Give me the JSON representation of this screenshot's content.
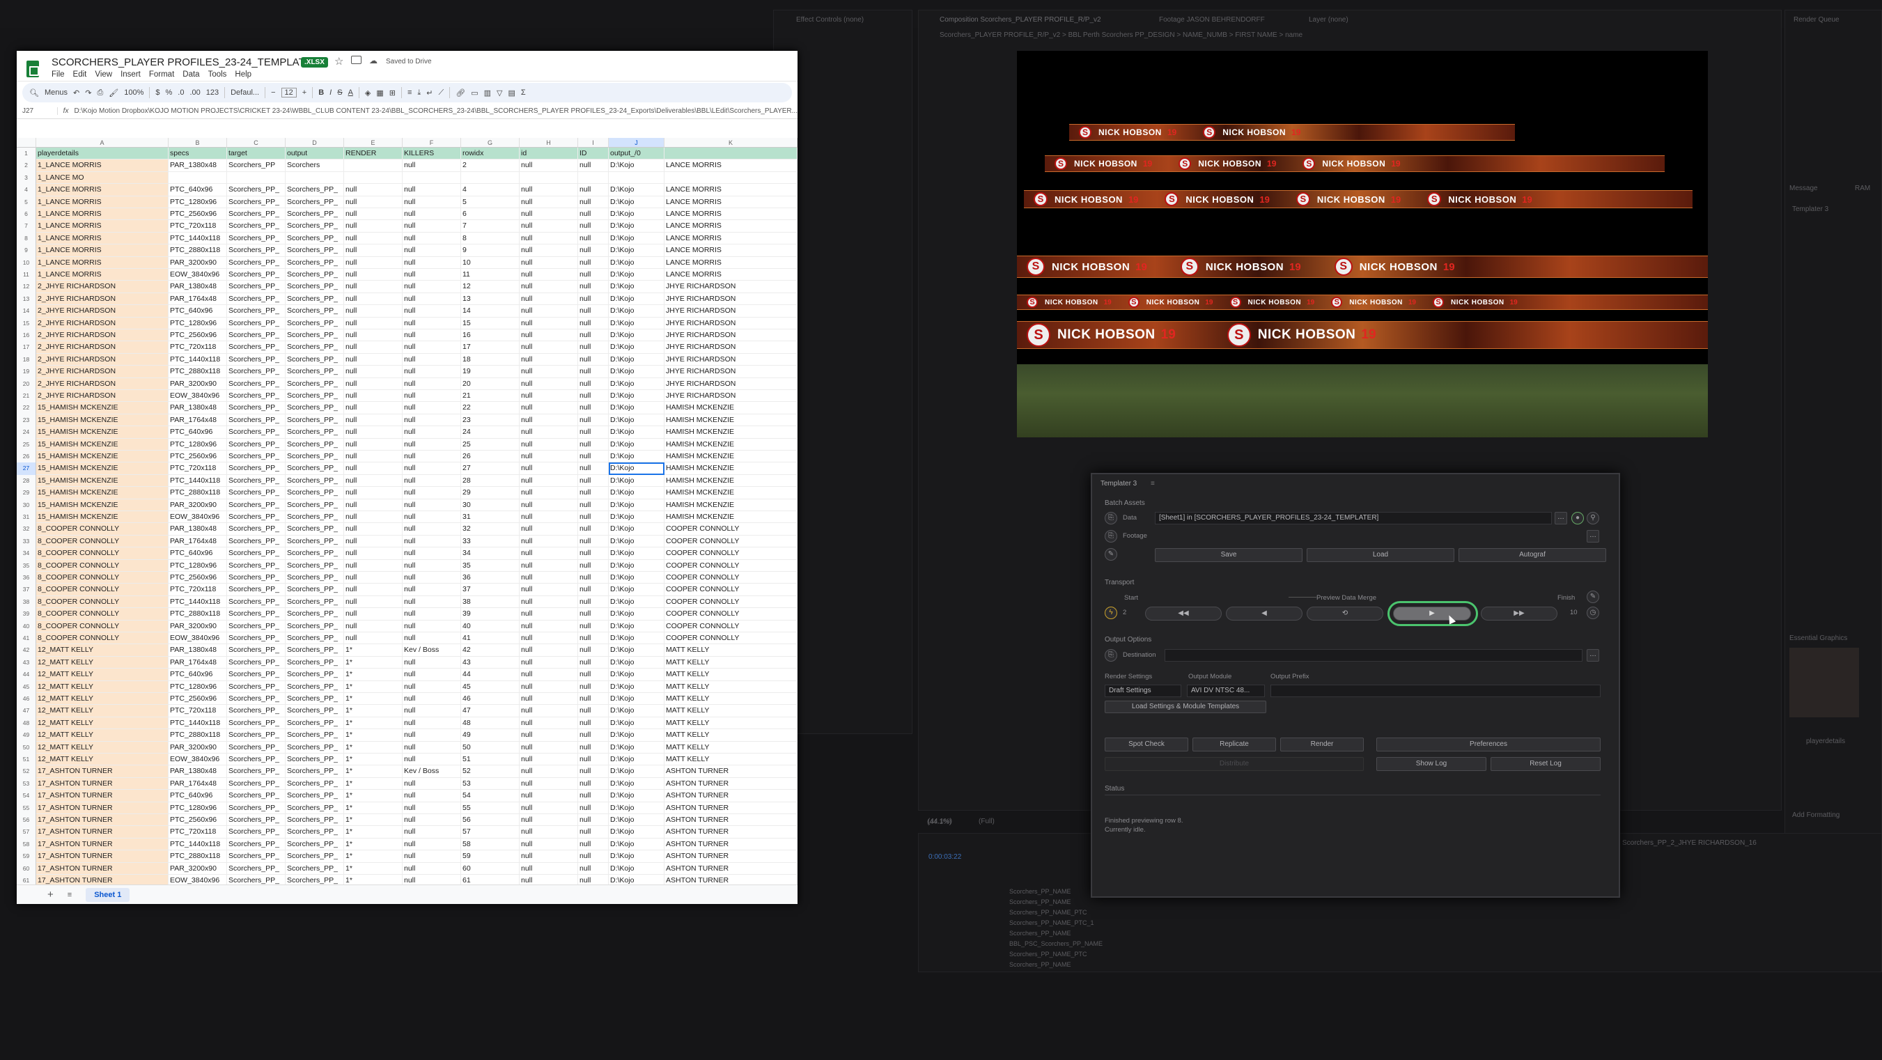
{
  "ae": {
    "effect_controls": "Effect Controls (none)",
    "comp_tab": "Composition Scorchers_PLAYER PROFILE_R/P_v2",
    "footage_tab": "Footage JASON BEHRENDORFF",
    "layer_tab": "Layer (none)",
    "render_queue": "Render Queue",
    "comp_breadcrumb": "Scorchers_PLAYER PROFILE_R/P_v2  >  BBL Perth Scorchers PP_DESIGN  >  NAME_NUMB  >  FIRST NAME  >  name",
    "zoom": "(44.1%)",
    "resolution": "(Full)",
    "timecode": "0:00:03:22",
    "timeline_tab": "Scorchers_PP_2_JHYE RICHARDSON_16",
    "right_tabs": [
      "Message",
      "RAM"
    ],
    "right_panel_title": "Templater 3",
    "essential_graphics": "Essential Graphics",
    "eg_layer": "playerdetails",
    "add_formatting": "Add Formatting",
    "layer_rows": [
      "Scorchers_PP_NAME",
      "Scorchers_PP_NAME",
      "Scorchers_PP_NAME_PTC",
      "Scorchers_PP_NAME_PTC_1",
      "Scorchers_PP_NAME",
      "BBL_PSC_Scorchers_PP_NAME",
      "Scorchers_PP_NAME_PTC",
      "Scorchers_PP_NAME"
    ]
  },
  "sheets": {
    "title": "SCORCHERS_PLAYER PROFILES_23-24_TEMPLATER",
    "badge": ".XLSX",
    "saved": "Saved to Drive",
    "menu": [
      "File",
      "Edit",
      "View",
      "Insert",
      "Format",
      "Data",
      "Tools",
      "Help"
    ],
    "toolbar": {
      "search": "Menus",
      "zoom": "100%",
      "currency": "$",
      "percent": "%",
      "dec1": ".0",
      "dec2": ".00",
      "fmt": "123",
      "font": "Defaul...",
      "size": "12"
    },
    "cell_ref": "J27",
    "formula": "D:\\Kojo Motion Dropbox\\KOJO MOTION PROJECTS\\CRICKET 23-24\\WBBL_CLUB CONTENT 23-24\\BBL_SCORCHERS_23-24\\BBL_SCORCHERS_PLAYER PROFILES_23-24_Exports\\Deliverables\\BBL\\LEdit\\Scorchers_PLAYER...",
    "columns": [
      "A",
      "B",
      "C",
      "D",
      "E",
      "F",
      "G",
      "H",
      "I",
      "J",
      "K"
    ],
    "header_row": [
      "playerdetails",
      "specs",
      "target",
      "output",
      "RENDER",
      "KILLERS",
      "rowidx",
      "id",
      "ID",
      "output_/0",
      ""
    ],
    "rows": [
      [
        "1_LANCE MORRIS",
        "PAR_1380x48",
        "Scorchers_PP",
        "Scorchers",
        "",
        "null",
        "2",
        "null",
        "null",
        "D:\\Kojo",
        "LANCE MORRIS"
      ],
      [
        "1_LANCE MO",
        "",
        "",
        "",
        "",
        "",
        "",
        "",
        "",
        "",
        ""
      ],
      [
        "1_LANCE MORRIS",
        "PTC_640x96",
        "Scorchers_PP_",
        "Scorchers_PP_",
        "null",
        "null",
        "4",
        "null",
        "null",
        "D:\\Kojo",
        "LANCE MORRIS"
      ],
      [
        "1_LANCE MORRIS",
        "PTC_1280x96",
        "Scorchers_PP_",
        "Scorchers_PP_",
        "null",
        "null",
        "5",
        "null",
        "null",
        "D:\\Kojo",
        "LANCE MORRIS"
      ],
      [
        "1_LANCE MORRIS",
        "PTC_2560x96",
        "Scorchers_PP_",
        "Scorchers_PP_",
        "null",
        "null",
        "6",
        "null",
        "null",
        "D:\\Kojo",
        "LANCE MORRIS"
      ],
      [
        "1_LANCE MORRIS",
        "PTC_720x118",
        "Scorchers_PP_",
        "Scorchers_PP_",
        "null",
        "null",
        "7",
        "null",
        "null",
        "D:\\Kojo",
        "LANCE MORRIS"
      ],
      [
        "1_LANCE MORRIS",
        "PTC_1440x118",
        "Scorchers_PP_",
        "Scorchers_PP_",
        "null",
        "null",
        "8",
        "null",
        "null",
        "D:\\Kojo",
        "LANCE MORRIS"
      ],
      [
        "1_LANCE MORRIS",
        "PTC_2880x118",
        "Scorchers_PP_",
        "Scorchers_PP_",
        "null",
        "null",
        "9",
        "null",
        "null",
        "D:\\Kojo",
        "LANCE MORRIS"
      ],
      [
        "1_LANCE MORRIS",
        "PAR_3200x90",
        "Scorchers_PP_",
        "Scorchers_PP_",
        "null",
        "null",
        "10",
        "null",
        "null",
        "D:\\Kojo",
        "LANCE MORRIS"
      ],
      [
        "1_LANCE MORRIS",
        "EOW_3840x96",
        "Scorchers_PP_",
        "Scorchers_PP_",
        "null",
        "null",
        "11",
        "null",
        "null",
        "D:\\Kojo",
        "LANCE MORRIS"
      ],
      [
        "2_JHYE RICHARDSON",
        "PAR_1380x48",
        "Scorchers_PP_",
        "Scorchers_PP_",
        "null",
        "null",
        "12",
        "null",
        "null",
        "D:\\Kojo",
        "JHYE RICHARDSON"
      ],
      [
        "2_JHYE RICHARDSON",
        "PAR_1764x48",
        "Scorchers_PP_",
        "Scorchers_PP_",
        "null",
        "null",
        "13",
        "null",
        "null",
        "D:\\Kojo",
        "JHYE RICHARDSON"
      ],
      [
        "2_JHYE RICHARDSON",
        "PTC_640x96",
        "Scorchers_PP_",
        "Scorchers_PP_",
        "null",
        "null",
        "14",
        "null",
        "null",
        "D:\\Kojo",
        "JHYE RICHARDSON"
      ],
      [
        "2_JHYE RICHARDSON",
        "PTC_1280x96",
        "Scorchers_PP_",
        "Scorchers_PP_",
        "null",
        "null",
        "15",
        "null",
        "null",
        "D:\\Kojo",
        "JHYE RICHARDSON"
      ],
      [
        "2_JHYE RICHARDSON",
        "PTC_2560x96",
        "Scorchers_PP_",
        "Scorchers_PP_",
        "null",
        "null",
        "16",
        "null",
        "null",
        "D:\\Kojo",
        "JHYE RICHARDSON"
      ],
      [
        "2_JHYE RICHARDSON",
        "PTC_720x118",
        "Scorchers_PP_",
        "Scorchers_PP_",
        "null",
        "null",
        "17",
        "null",
        "null",
        "D:\\Kojo",
        "JHYE RICHARDSON"
      ],
      [
        "2_JHYE RICHARDSON",
        "PTC_1440x118",
        "Scorchers_PP_",
        "Scorchers_PP_",
        "null",
        "null",
        "18",
        "null",
        "null",
        "D:\\Kojo",
        "JHYE RICHARDSON"
      ],
      [
        "2_JHYE RICHARDSON",
        "PTC_2880x118",
        "Scorchers_PP_",
        "Scorchers_PP_",
        "null",
        "null",
        "19",
        "null",
        "null",
        "D:\\Kojo",
        "JHYE RICHARDSON"
      ],
      [
        "2_JHYE RICHARDSON",
        "PAR_3200x90",
        "Scorchers_PP_",
        "Scorchers_PP_",
        "null",
        "null",
        "20",
        "null",
        "null",
        "D:\\Kojo",
        "JHYE RICHARDSON"
      ],
      [
        "2_JHYE RICHARDSON",
        "EOW_3840x96",
        "Scorchers_PP_",
        "Scorchers_PP_",
        "null",
        "null",
        "21",
        "null",
        "null",
        "D:\\Kojo",
        "JHYE RICHARDSON"
      ],
      [
        "15_HAMISH MCKENZIE",
        "PAR_1380x48",
        "Scorchers_PP_",
        "Scorchers_PP_",
        "null",
        "null",
        "22",
        "null",
        "null",
        "D:\\Kojo",
        "HAMISH MCKENZIE"
      ],
      [
        "15_HAMISH MCKENZIE",
        "PAR_1764x48",
        "Scorchers_PP_",
        "Scorchers_PP_",
        "null",
        "null",
        "23",
        "null",
        "null",
        "D:\\Kojo",
        "HAMISH MCKENZIE"
      ],
      [
        "15_HAMISH MCKENZIE",
        "PTC_640x96",
        "Scorchers_PP_",
        "Scorchers_PP_",
        "null",
        "null",
        "24",
        "null",
        "null",
        "D:\\Kojo",
        "HAMISH MCKENZIE"
      ],
      [
        "15_HAMISH MCKENZIE",
        "PTC_1280x96",
        "Scorchers_PP_",
        "Scorchers_PP_",
        "null",
        "null",
        "25",
        "null",
        "null",
        "D:\\Kojo",
        "HAMISH MCKENZIE"
      ],
      [
        "15_HAMISH MCKENZIE",
        "PTC_2560x96",
        "Scorchers_PP_",
        "Scorchers_PP_",
        "null",
        "null",
        "26",
        "null",
        "null",
        "D:\\Kojo",
        "HAMISH MCKENZIE"
      ],
      [
        "15_HAMISH MCKENZIE",
        "PTC_720x118",
        "Scorchers_PP_",
        "Scorchers_PP_",
        "null",
        "null",
        "27",
        "null",
        "null",
        "D:\\Kojo",
        "HAMISH MCKENZIE"
      ],
      [
        "15_HAMISH MCKENZIE",
        "PTC_1440x118",
        "Scorchers_PP_",
        "Scorchers_PP_",
        "null",
        "null",
        "28",
        "null",
        "null",
        "D:\\Kojo",
        "HAMISH MCKENZIE"
      ],
      [
        "15_HAMISH MCKENZIE",
        "PTC_2880x118",
        "Scorchers_PP_",
        "Scorchers_PP_",
        "null",
        "null",
        "29",
        "null",
        "null",
        "D:\\Kojo",
        "HAMISH MCKENZIE"
      ],
      [
        "15_HAMISH MCKENZIE",
        "PAR_3200x90",
        "Scorchers_PP_",
        "Scorchers_PP_",
        "null",
        "null",
        "30",
        "null",
        "null",
        "D:\\Kojo",
        "HAMISH MCKENZIE"
      ],
      [
        "15_HAMISH MCKENZIE",
        "EOW_3840x96",
        "Scorchers_PP_",
        "Scorchers_PP_",
        "null",
        "null",
        "31",
        "null",
        "null",
        "D:\\Kojo",
        "HAMISH MCKENZIE"
      ],
      [
        "8_COOPER CONNOLLY",
        "PAR_1380x48",
        "Scorchers_PP_",
        "Scorchers_PP_",
        "null",
        "null",
        "32",
        "null",
        "null",
        "D:\\Kojo",
        "COOPER CONNOLLY"
      ],
      [
        "8_COOPER CONNOLLY",
        "PAR_1764x48",
        "Scorchers_PP_",
        "Scorchers_PP_",
        "null",
        "null",
        "33",
        "null",
        "null",
        "D:\\Kojo",
        "COOPER CONNOLLY"
      ],
      [
        "8_COOPER CONNOLLY",
        "PTC_640x96",
        "Scorchers_PP_",
        "Scorchers_PP_",
        "null",
        "null",
        "34",
        "null",
        "null",
        "D:\\Kojo",
        "COOPER CONNOLLY"
      ],
      [
        "8_COOPER CONNOLLY",
        "PTC_1280x96",
        "Scorchers_PP_",
        "Scorchers_PP_",
        "null",
        "null",
        "35",
        "null",
        "null",
        "D:\\Kojo",
        "COOPER CONNOLLY"
      ],
      [
        "8_COOPER CONNOLLY",
        "PTC_2560x96",
        "Scorchers_PP_",
        "Scorchers_PP_",
        "null",
        "null",
        "36",
        "null",
        "null",
        "D:\\Kojo",
        "COOPER CONNOLLY"
      ],
      [
        "8_COOPER CONNOLLY",
        "PTC_720x118",
        "Scorchers_PP_",
        "Scorchers_PP_",
        "null",
        "null",
        "37",
        "null",
        "null",
        "D:\\Kojo",
        "COOPER CONNOLLY"
      ],
      [
        "8_COOPER CONNOLLY",
        "PTC_1440x118",
        "Scorchers_PP_",
        "Scorchers_PP_",
        "null",
        "null",
        "38",
        "null",
        "null",
        "D:\\Kojo",
        "COOPER CONNOLLY"
      ],
      [
        "8_COOPER CONNOLLY",
        "PTC_2880x118",
        "Scorchers_PP_",
        "Scorchers_PP_",
        "null",
        "null",
        "39",
        "null",
        "null",
        "D:\\Kojo",
        "COOPER CONNOLLY"
      ],
      [
        "8_COOPER CONNOLLY",
        "PAR_3200x90",
        "Scorchers_PP_",
        "Scorchers_PP_",
        "null",
        "null",
        "40",
        "null",
        "null",
        "D:\\Kojo",
        "COOPER CONNOLLY"
      ],
      [
        "8_COOPER CONNOLLY",
        "EOW_3840x96",
        "Scorchers_PP_",
        "Scorchers_PP_",
        "null",
        "null",
        "41",
        "null",
        "null",
        "D:\\Kojo",
        "COOPER CONNOLLY"
      ],
      [
        "12_MATT KELLY",
        "PAR_1380x48",
        "Scorchers_PP_",
        "Scorchers_PP_",
        "1*",
        "Kev / Boss",
        "42",
        "null",
        "null",
        "D:\\Kojo",
        "MATT KELLY"
      ],
      [
        "12_MATT KELLY",
        "PAR_1764x48",
        "Scorchers_PP_",
        "Scorchers_PP_",
        "1*",
        "null",
        "43",
        "null",
        "null",
        "D:\\Kojo",
        "MATT KELLY"
      ],
      [
        "12_MATT KELLY",
        "PTC_640x96",
        "Scorchers_PP_",
        "Scorchers_PP_",
        "1*",
        "null",
        "44",
        "null",
        "null",
        "D:\\Kojo",
        "MATT KELLY"
      ],
      [
        "12_MATT KELLY",
        "PTC_1280x96",
        "Scorchers_PP_",
        "Scorchers_PP_",
        "1*",
        "null",
        "45",
        "null",
        "null",
        "D:\\Kojo",
        "MATT KELLY"
      ],
      [
        "12_MATT KELLY",
        "PTC_2560x96",
        "Scorchers_PP_",
        "Scorchers_PP_",
        "1*",
        "null",
        "46",
        "null",
        "null",
        "D:\\Kojo",
        "MATT KELLY"
      ],
      [
        "12_MATT KELLY",
        "PTC_720x118",
        "Scorchers_PP_",
        "Scorchers_PP_",
        "1*",
        "null",
        "47",
        "null",
        "null",
        "D:\\Kojo",
        "MATT KELLY"
      ],
      [
        "12_MATT KELLY",
        "PTC_1440x118",
        "Scorchers_PP_",
        "Scorchers_PP_",
        "1*",
        "null",
        "48",
        "null",
        "null",
        "D:\\Kojo",
        "MATT KELLY"
      ],
      [
        "12_MATT KELLY",
        "PTC_2880x118",
        "Scorchers_PP_",
        "Scorchers_PP_",
        "1*",
        "null",
        "49",
        "null",
        "null",
        "D:\\Kojo",
        "MATT KELLY"
      ],
      [
        "12_MATT KELLY",
        "PAR_3200x90",
        "Scorchers_PP_",
        "Scorchers_PP_",
        "1*",
        "null",
        "50",
        "null",
        "null",
        "D:\\Kojo",
        "MATT KELLY"
      ],
      [
        "12_MATT KELLY",
        "EOW_3840x96",
        "Scorchers_PP_",
        "Scorchers_PP_",
        "1*",
        "null",
        "51",
        "null",
        "null",
        "D:\\Kojo",
        "MATT KELLY"
      ],
      [
        "17_ASHTON TURNER",
        "PAR_1380x48",
        "Scorchers_PP_",
        "Scorchers_PP_",
        "1*",
        "Kev / Boss",
        "52",
        "null",
        "null",
        "D:\\Kojo",
        "ASHTON TURNER"
      ],
      [
        "17_ASHTON TURNER",
        "PAR_1764x48",
        "Scorchers_PP_",
        "Scorchers_PP_",
        "1*",
        "null",
        "53",
        "null",
        "null",
        "D:\\Kojo",
        "ASHTON TURNER"
      ],
      [
        "17_ASHTON TURNER",
        "PTC_640x96",
        "Scorchers_PP_",
        "Scorchers_PP_",
        "1*",
        "null",
        "54",
        "null",
        "null",
        "D:\\Kojo",
        "ASHTON TURNER"
      ],
      [
        "17_ASHTON TURNER",
        "PTC_1280x96",
        "Scorchers_PP_",
        "Scorchers_PP_",
        "1*",
        "null",
        "55",
        "null",
        "null",
        "D:\\Kojo",
        "ASHTON TURNER"
      ],
      [
        "17_ASHTON TURNER",
        "PTC_2560x96",
        "Scorchers_PP_",
        "Scorchers_PP_",
        "1*",
        "null",
        "56",
        "null",
        "null",
        "D:\\Kojo",
        "ASHTON TURNER"
      ],
      [
        "17_ASHTON TURNER",
        "PTC_720x118",
        "Scorchers_PP_",
        "Scorchers_PP_",
        "1*",
        "null",
        "57",
        "null",
        "null",
        "D:\\Kojo",
        "ASHTON TURNER"
      ],
      [
        "17_ASHTON TURNER",
        "PTC_1440x118",
        "Scorchers_PP_",
        "Scorchers_PP_",
        "1*",
        "null",
        "58",
        "null",
        "null",
        "D:\\Kojo",
        "ASHTON TURNER"
      ],
      [
        "17_ASHTON TURNER",
        "PTC_2880x118",
        "Scorchers_PP_",
        "Scorchers_PP_",
        "1*",
        "null",
        "59",
        "null",
        "null",
        "D:\\Kojo",
        "ASHTON TURNER"
      ],
      [
        "17_ASHTON TURNER",
        "PAR_3200x90",
        "Scorchers_PP_",
        "Scorchers_PP_",
        "1*",
        "null",
        "60",
        "null",
        "null",
        "D:\\Kojo",
        "ASHTON TURNER"
      ],
      [
        "17_ASHTON TURNER",
        "EOW_3840x96",
        "Scorchers_PP_",
        "Scorchers_PP_",
        "1*",
        "null",
        "61",
        "null",
        "null",
        "D:\\Kojo",
        "ASHTON TURNER"
      ]
    ],
    "selected_row": 27,
    "sheet_tab": "Sheet 1"
  },
  "viewer": {
    "player_name": "NICK HOBSON",
    "player_number": "19",
    "logo_letter": "S",
    "accent": "#e12620"
  },
  "templater": {
    "title": "Templater 3",
    "batch_assets": "Batch Assets",
    "data_label": "Data",
    "data_value": "[Sheet1] in [SCORCHERS_PLAYER_PROFILES_23-24_TEMPLATER]",
    "footage_label": "Footage",
    "save": "Save",
    "load": "Load",
    "autograf": "Autograf",
    "transport": "Transport",
    "start": "Start",
    "start_value": "2",
    "preview_data_merge": "Preview Data Merge",
    "finish": "Finish",
    "finish_value": "10",
    "output_options": "Output Options",
    "destination": "Destination",
    "render_settings": "Render Settings",
    "render_settings_value": "Draft Settings",
    "output_module": "Output Module",
    "output_module_value": "AVI DV NTSC 48...",
    "output_prefix": "Output Prefix",
    "load_templates": "Load Settings & Module Templates",
    "spot_check": "Spot Check",
    "replicate": "Replicate",
    "render": "Render",
    "preferences": "Preferences",
    "distribute": "Distribute",
    "show_log": "Show Log",
    "reset_log": "Reset Log",
    "status": "Status",
    "status_line1": "Finished previewing row 8.",
    "status_line2": "Currently idle.",
    "highlight": "#4bc46e"
  }
}
